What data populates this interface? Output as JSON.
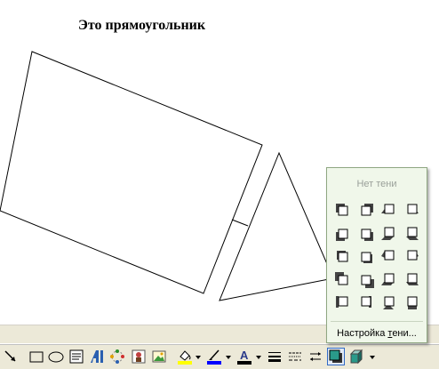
{
  "document": {
    "text": "Это прямоугольник"
  },
  "shadow_menu": {
    "no_shadow_label": "Нет тени",
    "settings_label_before": "Настройка ",
    "settings_label_underlined": "т",
    "settings_label_after": "ени...",
    "styles": [
      {
        "name": "shadow-style-1"
      },
      {
        "name": "shadow-style-2"
      },
      {
        "name": "shadow-style-3"
      },
      {
        "name": "shadow-style-4"
      },
      {
        "name": "shadow-style-5"
      },
      {
        "name": "shadow-style-6"
      },
      {
        "name": "shadow-style-7"
      },
      {
        "name": "shadow-style-8"
      },
      {
        "name": "shadow-style-9"
      },
      {
        "name": "shadow-style-10"
      },
      {
        "name": "shadow-style-11"
      },
      {
        "name": "shadow-style-12"
      },
      {
        "name": "shadow-style-13"
      },
      {
        "name": "shadow-style-14"
      },
      {
        "name": "shadow-style-15"
      },
      {
        "name": "shadow-style-16"
      },
      {
        "name": "shadow-style-17"
      },
      {
        "name": "shadow-style-18"
      },
      {
        "name": "shadow-style-19"
      },
      {
        "name": "shadow-style-20"
      }
    ]
  },
  "toolbar": {
    "buttons": [
      {
        "icon": "arrow-tool-icon"
      },
      {
        "icon": "rectangle-tool-icon"
      },
      {
        "icon": "oval-tool-icon"
      },
      {
        "icon": "text-box-icon"
      },
      {
        "icon": "wordart-icon"
      },
      {
        "icon": "diagram-icon"
      },
      {
        "icon": "clipart-icon"
      },
      {
        "icon": "picture-icon"
      },
      {
        "icon": "fill-color-icon",
        "color": "#ffff00"
      },
      {
        "icon": "line-color-icon",
        "color": "#0000ff"
      },
      {
        "icon": "font-color-icon",
        "color": "#000000"
      },
      {
        "icon": "line-style-icon"
      },
      {
        "icon": "dash-style-icon"
      },
      {
        "icon": "arrow-style-icon"
      },
      {
        "icon": "shadow-style-icon"
      },
      {
        "icon": "3d-style-icon"
      }
    ]
  }
}
